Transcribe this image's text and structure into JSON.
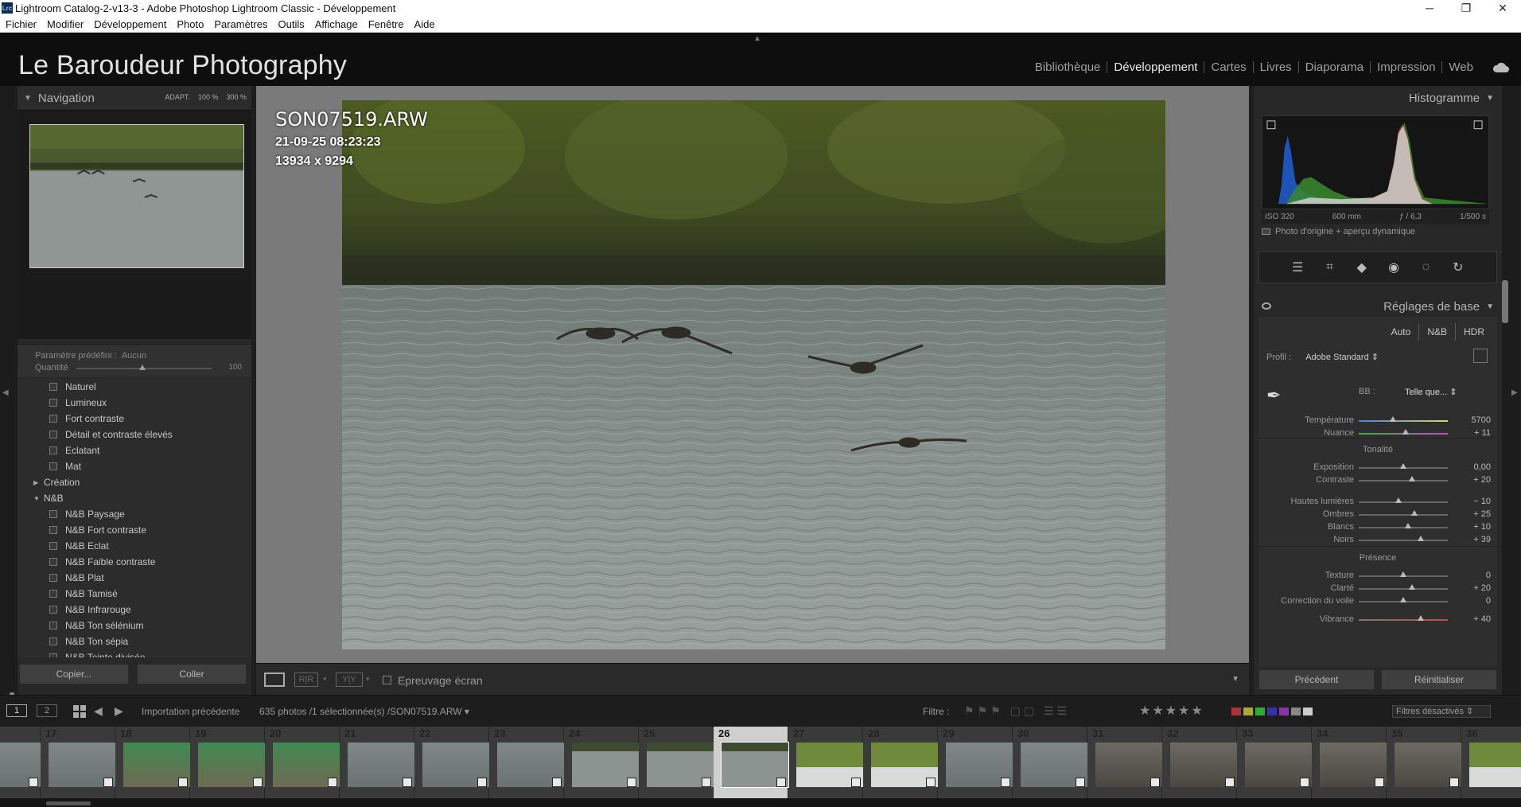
{
  "window": {
    "title": "Lightroom Catalog-2-v13-3 - Adobe Photoshop Lightroom Classic - Développement",
    "app_icon": "Lrc"
  },
  "menu": [
    "Fichier",
    "Modifier",
    "Développement",
    "Photo",
    "Paramètres",
    "Outils",
    "Affichage",
    "Fenêtre",
    "Aide"
  ],
  "identity_plate": "Le Baroudeur Photography",
  "modules": [
    "Bibliothèque",
    "Développement",
    "Cartes",
    "Livres",
    "Diaporama",
    "Impression",
    "Web"
  ],
  "navigator": {
    "title": "Navigation",
    "zoom_fit": "ADAPT.",
    "zoom_100": "100 %",
    "zoom_300": "300 %"
  },
  "preset_amount": {
    "label": "Paramètre prédéfini :",
    "value": "Aucun",
    "amount_label": "Quantité",
    "amount": "100"
  },
  "presets": [
    {
      "type": "item",
      "label": "Naturel"
    },
    {
      "type": "item",
      "label": "Lumineux"
    },
    {
      "type": "item",
      "label": "Fort contraste"
    },
    {
      "type": "item",
      "label": "Détail et contraste élevés"
    },
    {
      "type": "item",
      "label": "Eclatant"
    },
    {
      "type": "item",
      "label": "Mat"
    },
    {
      "type": "folder",
      "label": "Création",
      "open": false
    },
    {
      "type": "folder",
      "label": "N&B",
      "open": true
    },
    {
      "type": "item",
      "label": "N&B Paysage"
    },
    {
      "type": "item",
      "label": "N&B Fort contraste"
    },
    {
      "type": "item",
      "label": "N&B Eclat"
    },
    {
      "type": "item",
      "label": "N&B Faible contraste"
    },
    {
      "type": "item",
      "label": "N&B Plat"
    },
    {
      "type": "item",
      "label": "N&B Tamisé"
    },
    {
      "type": "item",
      "label": "N&B Infrarouge"
    },
    {
      "type": "item",
      "label": "N&B Ton sélénium"
    },
    {
      "type": "item",
      "label": "N&B Ton sépia"
    },
    {
      "type": "item",
      "label": "N&B Teinte divisée"
    }
  ],
  "left_buttons": {
    "copy": "Copier...",
    "paste": "Coller"
  },
  "photo_info": {
    "filename": "SON07519.ARW",
    "datetime": "21-09-25 08:23:23",
    "dimensions": "13934 x 9294"
  },
  "toolbar": {
    "proof_label": "Epreuvage écran",
    "view_rr": "R|R",
    "view_yy": "Y|Y"
  },
  "histogram": {
    "title": "Histogramme",
    "iso": "ISO 320",
    "focal": "600 mm",
    "aperture": "ƒ / 6,3",
    "shutter": "1/500 s",
    "original_label": "Photo d'origine + aperçu dynamique"
  },
  "basic": {
    "title": "Réglages de base",
    "treatments": [
      "Auto",
      "N&B",
      "HDR"
    ],
    "profile_label": "Profil :",
    "profile_value": "Adobe Standard",
    "wb_label": "BB :",
    "wb_value": "Telle que...",
    "tone_title": "Tonalité",
    "presence_title": "Présence",
    "sliders": [
      {
        "label": "Température",
        "value": "5700",
        "pos": 0.38
      },
      {
        "label": "Nuance",
        "value": "+ 11",
        "pos": 0.53
      },
      {
        "label": "Exposition",
        "value": "0,00",
        "pos": 0.5
      },
      {
        "label": "Contraste",
        "value": "+ 20",
        "pos": 0.6
      },
      {
        "label": "Hautes lumières",
        "value": "− 10",
        "pos": 0.45
      },
      {
        "label": "Ombres",
        "value": "+ 25",
        "pos": 0.625
      },
      {
        "label": "Blancs",
        "value": "+ 10",
        "pos": 0.55
      },
      {
        "label": "Noirs",
        "value": "+ 39",
        "pos": 0.695
      },
      {
        "label": "Texture",
        "value": "0",
        "pos": 0.5
      },
      {
        "label": "Clarté",
        "value": "+ 20",
        "pos": 0.6
      },
      {
        "label": "Correction du voile",
        "value": "0",
        "pos": 0.5
      },
      {
        "label": "Vibrance",
        "value": "+ 40",
        "pos": 0.7
      }
    ]
  },
  "right_buttons": {
    "previous": "Précédent",
    "reset": "Réinitialiser"
  },
  "filmbar": {
    "screen1": "1",
    "screen2": "2",
    "source": "Importation précédente",
    "count": "635 photos /1 sélectionnée(s) /SON07519.ARW",
    "filter_label": "Filtre :",
    "stars": "★★★★★",
    "filters_off": "Filtres désactivés"
  },
  "filmstrip": [
    {
      "num": "",
      "scene": "water"
    },
    {
      "num": "17",
      "scene": "water"
    },
    {
      "num": "18",
      "scene": "green"
    },
    {
      "num": "19",
      "scene": "green"
    },
    {
      "num": "20",
      "scene": "green"
    },
    {
      "num": "21",
      "scene": "water"
    },
    {
      "num": "22",
      "scene": "water"
    },
    {
      "num": "23",
      "scene": "water"
    },
    {
      "num": "24",
      "scene": "lake"
    },
    {
      "num": "25",
      "scene": "lake"
    },
    {
      "num": "26",
      "scene": "lake",
      "selected": true
    },
    {
      "num": "27",
      "scene": "trees"
    },
    {
      "num": "28",
      "scene": "trees"
    },
    {
      "num": "29",
      "scene": "water"
    },
    {
      "num": "30",
      "scene": "water"
    },
    {
      "num": "31",
      "scene": "ducks"
    },
    {
      "num": "32",
      "scene": "ducks"
    },
    {
      "num": "33",
      "scene": "ducks"
    },
    {
      "num": "34",
      "scene": "ducks"
    },
    {
      "num": "35",
      "scene": "ducks"
    },
    {
      "num": "36",
      "scene": "trees"
    }
  ]
}
